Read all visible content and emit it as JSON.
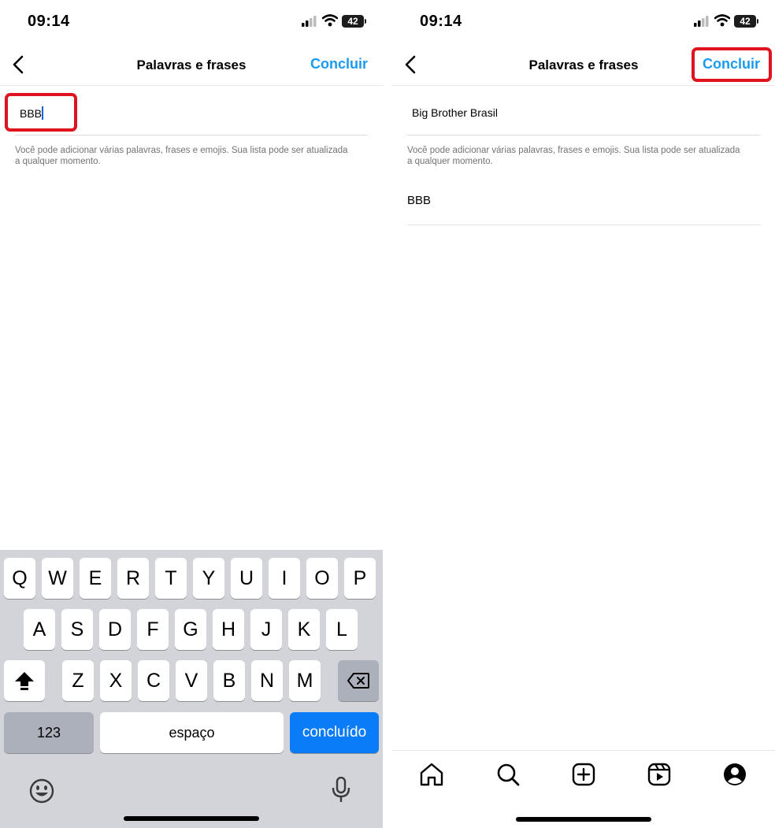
{
  "left": {
    "status": {
      "time": "09:14",
      "battery": "42"
    },
    "header": {
      "title": "Palavras e frases",
      "done_label": "Concluir"
    },
    "input": {
      "value": "BBB"
    },
    "helper_text": "Você pode adicionar várias palavras, frases e emojis. Sua lista pode ser atualizada a qualquer momento.",
    "keyboard": {
      "row1": [
        "Q",
        "W",
        "E",
        "R",
        "T",
        "Y",
        "U",
        "I",
        "O",
        "P"
      ],
      "row2": [
        "A",
        "S",
        "D",
        "F",
        "G",
        "H",
        "J",
        "K",
        "L"
      ],
      "row3": [
        "Z",
        "X",
        "C",
        "V",
        "B",
        "N",
        "M"
      ],
      "numbers_label": "123",
      "space_label": "espaço",
      "done_label": "concluído"
    }
  },
  "right": {
    "status": {
      "time": "09:14",
      "battery": "42"
    },
    "header": {
      "title": "Palavras e frases",
      "done_label": "Concluir"
    },
    "input": {
      "value": "Big Brother Brasil"
    },
    "helper_text": "Você pode adicionar várias palavras, frases e emojis. Sua lista pode ser atualizada a qualquer momento.",
    "words": [
      "BBB"
    ]
  },
  "colors": {
    "accent": "#1a9af0",
    "highlight": "#e0141e",
    "keyboard_bg": "#d2d4da",
    "return_key": "#0a7cf8"
  },
  "icons": [
    "back-chevron-icon",
    "cellular-signal-icon",
    "wifi-icon",
    "battery-icon",
    "shift-icon",
    "backspace-icon",
    "emoji-icon",
    "microphone-icon",
    "home-icon",
    "search-icon",
    "create-icon",
    "reels-icon",
    "profile-icon"
  ]
}
